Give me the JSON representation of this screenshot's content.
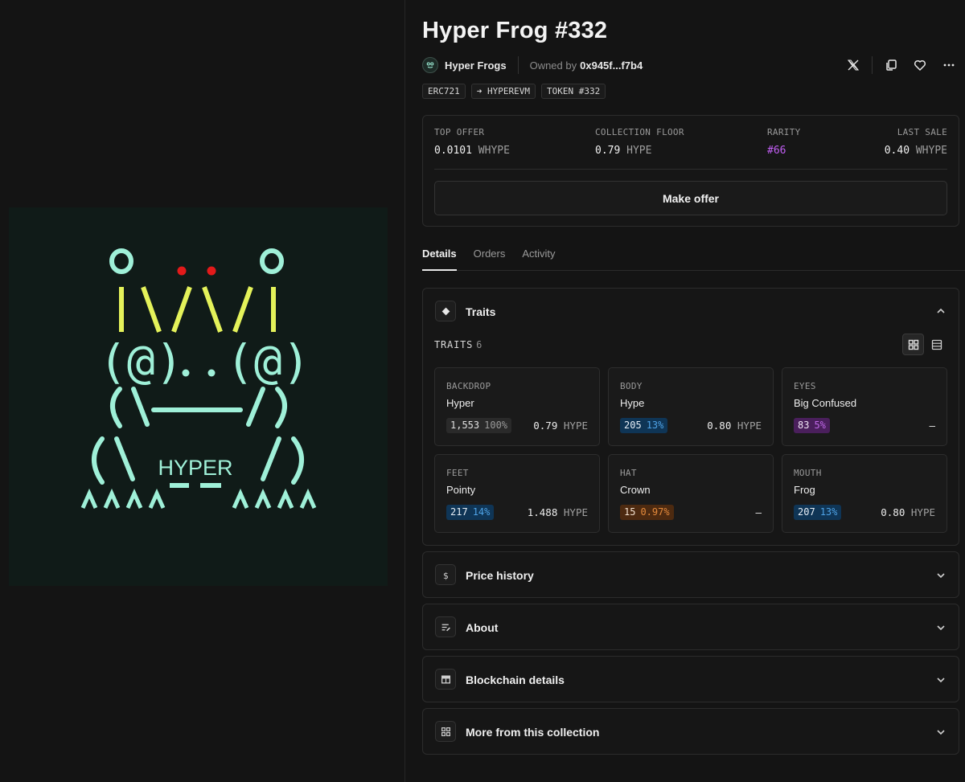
{
  "nft": {
    "title": "Hyper Frog #332",
    "art_text": "HYPER"
  },
  "collection": {
    "name": "Hyper Frogs",
    "owned_by_label": "Owned by",
    "owner": "0x945f...f7b4"
  },
  "chips": [
    "ERC721",
    "➜ HYPEREVM",
    "TOKEN #332"
  ],
  "actions": {
    "icons": [
      "x-logo-icon",
      "copy-icon",
      "heart-icon",
      "more-icon"
    ]
  },
  "stats": {
    "top_offer": {
      "label": "TOP OFFER",
      "value": "0.0101",
      "unit": "WHYPE"
    },
    "floor": {
      "label": "COLLECTION FLOOR",
      "value": "0.79",
      "unit": "HYPE"
    },
    "rarity": {
      "label": "RARITY",
      "value": "#66"
    },
    "last_sale": {
      "label": "LAST SALE",
      "value": "0.40",
      "unit": "WHYPE"
    }
  },
  "make_offer_label": "Make offer",
  "tabs": [
    {
      "label": "Details",
      "active": true
    },
    {
      "label": "Orders",
      "active": false
    },
    {
      "label": "Activity",
      "active": false
    }
  ],
  "traits_section": {
    "title": "Traits",
    "sub_label": "TRAITS",
    "count": "6",
    "traits": [
      {
        "type": "BACKDROP",
        "value": "Hyper",
        "count": "1,553",
        "pct": "100%",
        "price": "0.79",
        "unit": "HYPE",
        "color": "gray"
      },
      {
        "type": "BODY",
        "value": "Hype",
        "count": "205",
        "pct": "13%",
        "price": "0.80",
        "unit": "HYPE",
        "color": "blue"
      },
      {
        "type": "EYES",
        "value": "Big Confused",
        "count": "83",
        "pct": "5%",
        "price": "–",
        "unit": "",
        "color": "purple"
      },
      {
        "type": "FEET",
        "value": "Pointy",
        "count": "217",
        "pct": "14%",
        "price": "1.488",
        "unit": "HYPE",
        "color": "blue"
      },
      {
        "type": "HAT",
        "value": "Crown",
        "count": "15",
        "pct": "0.97%",
        "price": "–",
        "unit": "",
        "color": "orange"
      },
      {
        "type": "MOUTH",
        "value": "Frog",
        "count": "207",
        "pct": "13%",
        "price": "0.80",
        "unit": "HYPE",
        "color": "blue"
      }
    ]
  },
  "accordions": [
    {
      "title": "Price history",
      "icon": "dollar-icon"
    },
    {
      "title": "About",
      "icon": "text-edit-icon"
    },
    {
      "title": "Blockchain details",
      "icon": "table-icon"
    },
    {
      "title": "More from this collection",
      "icon": "grid-icon"
    }
  ],
  "colors": {
    "background": "#141414",
    "art_background": "#101b18",
    "art_mint": "#9ff0d8",
    "art_yellow": "#e4f25a",
    "art_red": "#e21a1a",
    "rarity": "#c35ff5"
  }
}
